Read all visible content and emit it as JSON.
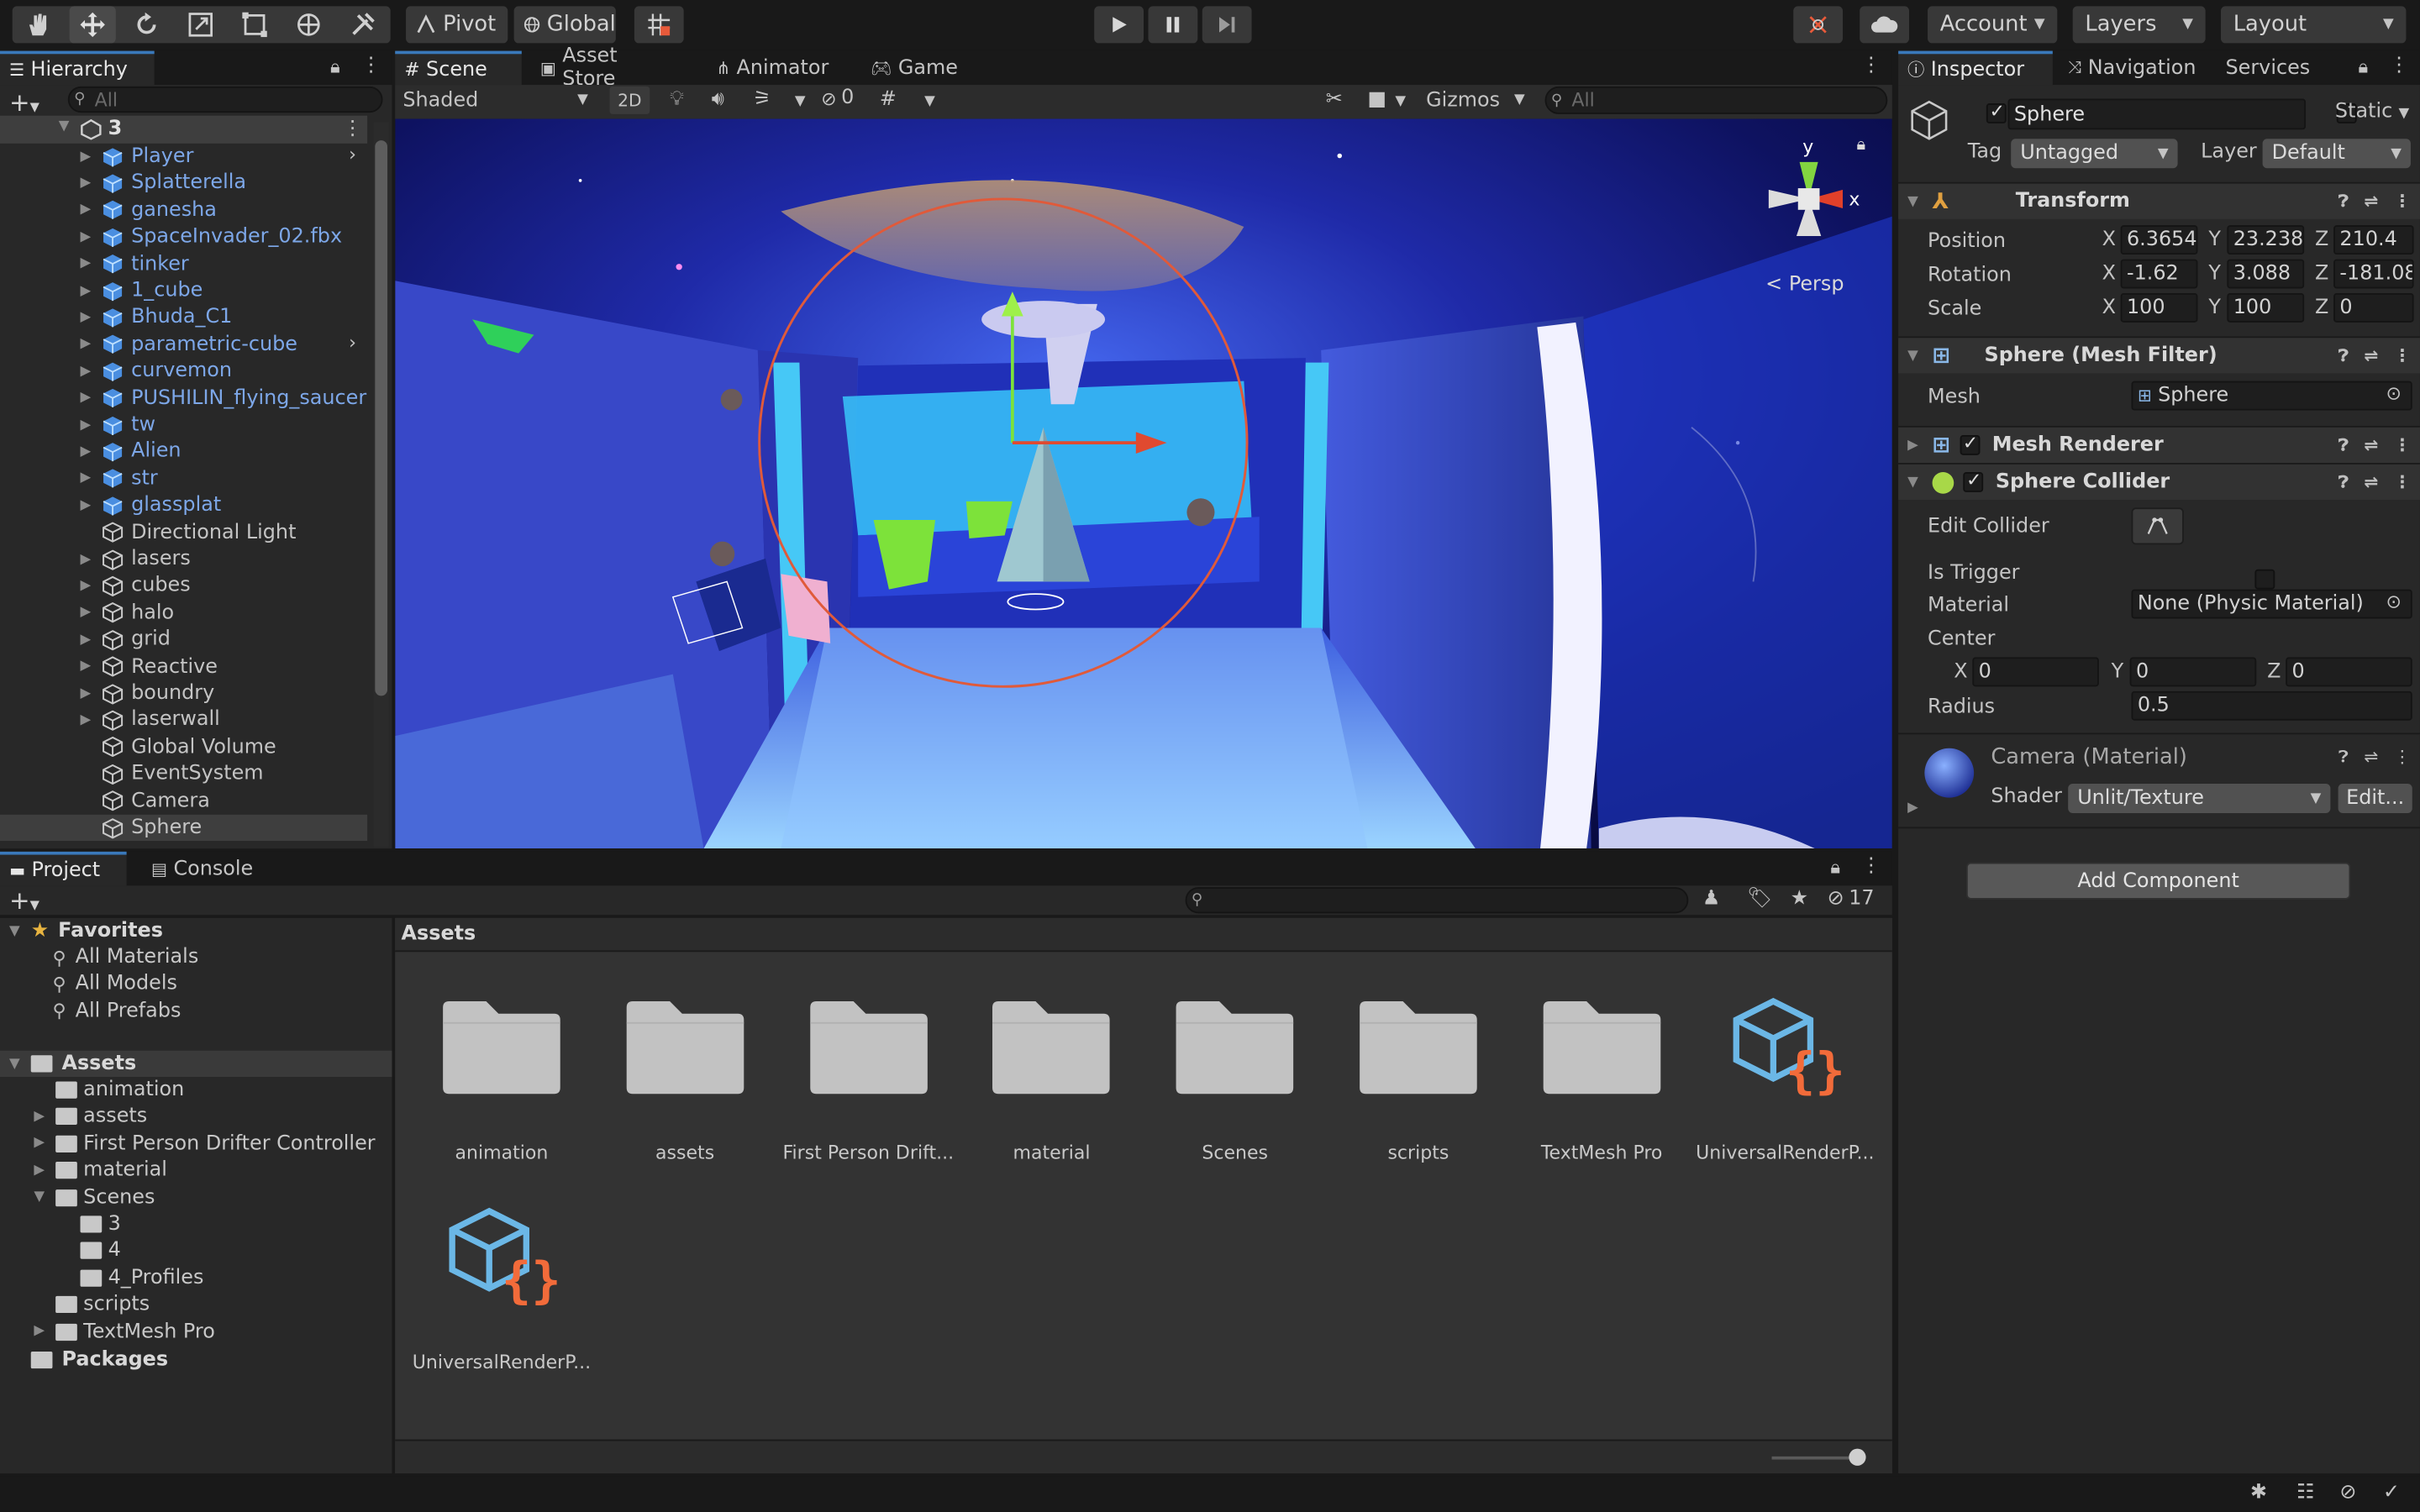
{
  "toolbar": {
    "pivot": "Pivot",
    "global": "Global",
    "account": "Account",
    "layers": "Layers",
    "layout": "Layout"
  },
  "hierarchy": {
    "tab": "Hierarchy",
    "search_placeholder": "All",
    "scene": "3",
    "items": [
      {
        "label": "Player",
        "prefab": true
      },
      {
        "label": "Splatterella",
        "prefab": true
      },
      {
        "label": "ganesha",
        "prefab": true
      },
      {
        "label": "SpaceInvader_02.fbx",
        "prefab": true
      },
      {
        "label": "tinker",
        "prefab": true
      },
      {
        "label": "1_cube",
        "prefab": true
      },
      {
        "label": "Bhuda_C1",
        "prefab": true
      },
      {
        "label": "parametric-cube",
        "prefab": true
      },
      {
        "label": "curvemon",
        "prefab": true
      },
      {
        "label": "PUSHILIN_flying_saucer",
        "prefab": true
      },
      {
        "label": "tw",
        "prefab": true
      },
      {
        "label": "Alien",
        "prefab": true
      },
      {
        "label": "str",
        "prefab": true
      },
      {
        "label": "glassplat",
        "prefab": true
      },
      {
        "label": "Directional Light",
        "prefab": false
      },
      {
        "label": "lasers",
        "prefab": false
      },
      {
        "label": "cubes",
        "prefab": false
      },
      {
        "label": "halo",
        "prefab": false
      },
      {
        "label": "grid",
        "prefab": false
      },
      {
        "label": "Reactive",
        "prefab": false
      },
      {
        "label": "boundry",
        "prefab": false
      },
      {
        "label": "laserwall",
        "prefab": false
      },
      {
        "label": "Global Volume",
        "prefab": false
      },
      {
        "label": "EventSystem",
        "prefab": false
      },
      {
        "label": "Camera",
        "prefab": false
      },
      {
        "label": "Sphere",
        "prefab": false
      }
    ]
  },
  "scene_tabs": [
    "Scene",
    "Asset Store",
    "Animator",
    "Game"
  ],
  "scene_toolbar": {
    "shading": "Shaded",
    "mode_2d": "2D",
    "hidden_count": "0",
    "gizmos": "Gizmos",
    "search_placeholder": "All",
    "persp": "Persp",
    "axis_x": "x",
    "axis_y": "y"
  },
  "inspector": {
    "tabs": [
      "Inspector",
      "Navigation",
      "Services"
    ],
    "object_name": "Sphere",
    "static_label": "Static",
    "tag_label": "Tag",
    "tag_value": "Untagged",
    "layer_label": "Layer",
    "layer_value": "Default",
    "transform": {
      "title": "Transform",
      "position_label": "Position",
      "rotation_label": "Rotation",
      "scale_label": "Scale",
      "position": {
        "x": "6.3654",
        "y": "23.238",
        "z": "210.4"
      },
      "rotation": {
        "x": "-1.62",
        "y": "3.088",
        "z": "-181.08"
      },
      "scale": {
        "x": "100",
        "y": "100",
        "z": "0"
      }
    },
    "mesh_filter": {
      "title": "Sphere (Mesh Filter)",
      "mesh_label": "Mesh",
      "mesh_value": "Sphere"
    },
    "mesh_renderer": {
      "title": "Mesh Renderer"
    },
    "sphere_collider": {
      "title": "Sphere Collider",
      "edit_collider": "Edit Collider",
      "is_trigger": "Is Trigger",
      "material_label": "Material",
      "material_value": "None (Physic Material)",
      "center_label": "Center",
      "center": {
        "x": "0",
        "y": "0",
        "z": "0"
      },
      "radius_label": "Radius",
      "radius": "0.5"
    },
    "material": {
      "title": "Camera (Material)",
      "shader_label": "Shader",
      "shader_value": "Unlit/Texture",
      "edit": "Edit..."
    },
    "add_component": "Add Component"
  },
  "project": {
    "tabs": [
      "Project",
      "Console"
    ],
    "hidden_count": "17",
    "breadcrumb": "Assets",
    "favorites": {
      "title": "Favorites",
      "items": [
        "All Materials",
        "All Models",
        "All Prefabs"
      ]
    },
    "assets_root": "Assets",
    "tree": [
      {
        "label": "animation",
        "indent": 1,
        "arrow": false
      },
      {
        "label": "assets",
        "indent": 1,
        "arrow": true
      },
      {
        "label": "First Person Drifter Controller",
        "indent": 1,
        "arrow": true
      },
      {
        "label": "material",
        "indent": 1,
        "arrow": true
      },
      {
        "label": "Scenes",
        "indent": 1,
        "arrow": "open"
      },
      {
        "label": "3",
        "indent": 2,
        "arrow": false
      },
      {
        "label": "4",
        "indent": 2,
        "arrow": false
      },
      {
        "label": "4_Profiles",
        "indent": 2,
        "arrow": false
      },
      {
        "label": "scripts",
        "indent": 1,
        "arrow": false
      },
      {
        "label": "TextMesh Pro",
        "indent": 1,
        "arrow": true
      }
    ],
    "packages": "Packages",
    "grid": [
      {
        "label": "animation",
        "kind": "folder"
      },
      {
        "label": "assets",
        "kind": "folder"
      },
      {
        "label": "First Person Drift...",
        "kind": "folder"
      },
      {
        "label": "material",
        "kind": "folder"
      },
      {
        "label": "Scenes",
        "kind": "folder"
      },
      {
        "label": "scripts",
        "kind": "folder"
      },
      {
        "label": "TextMesh Pro",
        "kind": "folder"
      },
      {
        "label": "UniversalRenderP...",
        "kind": "asset"
      },
      {
        "label": "UniversalRenderP...",
        "kind": "asset"
      }
    ]
  },
  "colors": {
    "accent": "#3a79bb",
    "prefab_text": "#7da7e8",
    "panel": "#282828",
    "toolbar": "#191919",
    "asset_orange": "#f26b3a",
    "asset_blue": "#6bb7e6"
  }
}
